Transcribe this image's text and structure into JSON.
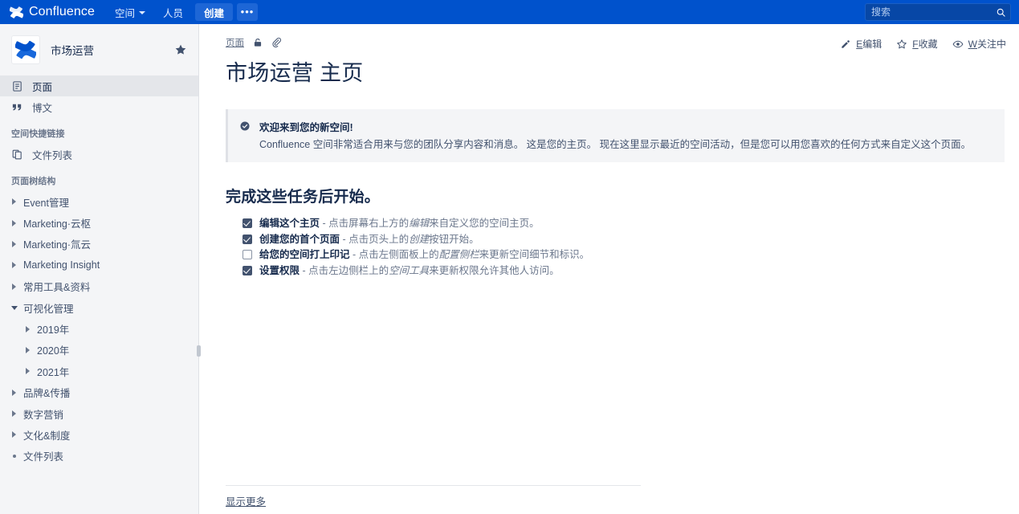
{
  "topnav": {
    "brand_name": "Confluence",
    "brand_logo_icon": "confluence-logo-icon",
    "items": [
      {
        "label": "空间",
        "has_caret": true
      },
      {
        "label": "人员",
        "has_caret": false
      }
    ],
    "create_label": "创建",
    "more_label": "•••",
    "search": {
      "placeholder": "搜索",
      "value": "",
      "icon": "search-icon"
    }
  },
  "sidebar": {
    "space_name": "市场运营",
    "space_avatar_icon": "confluence-space-avatar-icon",
    "star_icon": "star-filled-icon",
    "links": [
      {
        "label": "页面",
        "icon": "pages-icon",
        "active": true
      },
      {
        "label": "博文",
        "icon": "blog-quote-icon",
        "active": false
      }
    ],
    "shortcuts_title": "空间快捷链接",
    "shortcuts": [
      {
        "label": "文件列表",
        "icon": "copy-file-icon"
      }
    ],
    "tree_title": "页面树结构",
    "tree": [
      {
        "label": "Event管理",
        "state": "collapsed",
        "level": 1
      },
      {
        "label": "Marketing·云枢",
        "state": "collapsed",
        "level": 1
      },
      {
        "label": "Marketing·氚云",
        "state": "collapsed",
        "level": 1
      },
      {
        "label": "Marketing Insight",
        "state": "collapsed",
        "level": 1
      },
      {
        "label": "常用工具&资料",
        "state": "collapsed",
        "level": 1
      },
      {
        "label": "可视化管理",
        "state": "expanded",
        "level": 1
      },
      {
        "label": "2019年",
        "state": "collapsed",
        "level": 2
      },
      {
        "label": "2020年",
        "state": "collapsed",
        "level": 2
      },
      {
        "label": "2021年",
        "state": "collapsed",
        "level": 2
      },
      {
        "label": "品牌&传播",
        "state": "collapsed",
        "level": 1
      },
      {
        "label": "数字营销",
        "state": "collapsed",
        "level": 1
      },
      {
        "label": "文化&制度",
        "state": "collapsed",
        "level": 1
      },
      {
        "label": "文件列表",
        "state": "leaf",
        "level": 1
      }
    ]
  },
  "main": {
    "breadcrumb": "页面",
    "breadcrumb_icons": [
      "restrictions-lock-icon",
      "attachment-paperclip-icon"
    ],
    "page_title": "市场运营 主页",
    "actions": [
      {
        "icon": "pencil-edit-icon",
        "shortcut": "E",
        "label": "编辑"
      },
      {
        "icon": "star-outline-icon",
        "shortcut": "F",
        "label": "收藏"
      },
      {
        "icon": "eye-watch-icon",
        "shortcut": "W",
        "label": "关注中"
      }
    ],
    "banner": {
      "icon": "check-circle-icon",
      "title": "欢迎来到您的新空间!",
      "body": "Confluence 空间非常适合用来与您的团队分享内容和消息。 这是您的主页。 现在这里显示最近的空间活动，但是您可以用您喜欢的任何方式来自定义这个页面。"
    },
    "tasks_heading": "完成这些任务后开始。",
    "tasks": [
      {
        "checked": true,
        "bold": "编辑这个主页",
        "sep": " - ",
        "pre": "点击屏幕右上方的",
        "em": "编辑",
        "post": "来自定义您的空间主页。"
      },
      {
        "checked": true,
        "bold": "创建您的首个页面",
        "sep": " - ",
        "pre": "点击页头上的",
        "em": "创建",
        "post": "按钮开始。"
      },
      {
        "checked": false,
        "bold": "给您的空间打上印记",
        "sep": " - ",
        "pre": "点击左侧面板上的",
        "em": "配置侧栏",
        "post": "来更新空间细节和标识。"
      },
      {
        "checked": true,
        "bold": "设置权限",
        "sep": " - ",
        "pre": "点击左边侧栏上的",
        "em": "空间工具",
        "post": "来更新权限允许其他人访问。"
      }
    ],
    "show_more": "显示更多"
  },
  "colors": {
    "nav_blue": "#0052cc",
    "sidebar_bg": "#f4f5f7",
    "text_dark": "#172b4d",
    "text_muted": "#6b778c",
    "link_blue": "#0052cc"
  }
}
